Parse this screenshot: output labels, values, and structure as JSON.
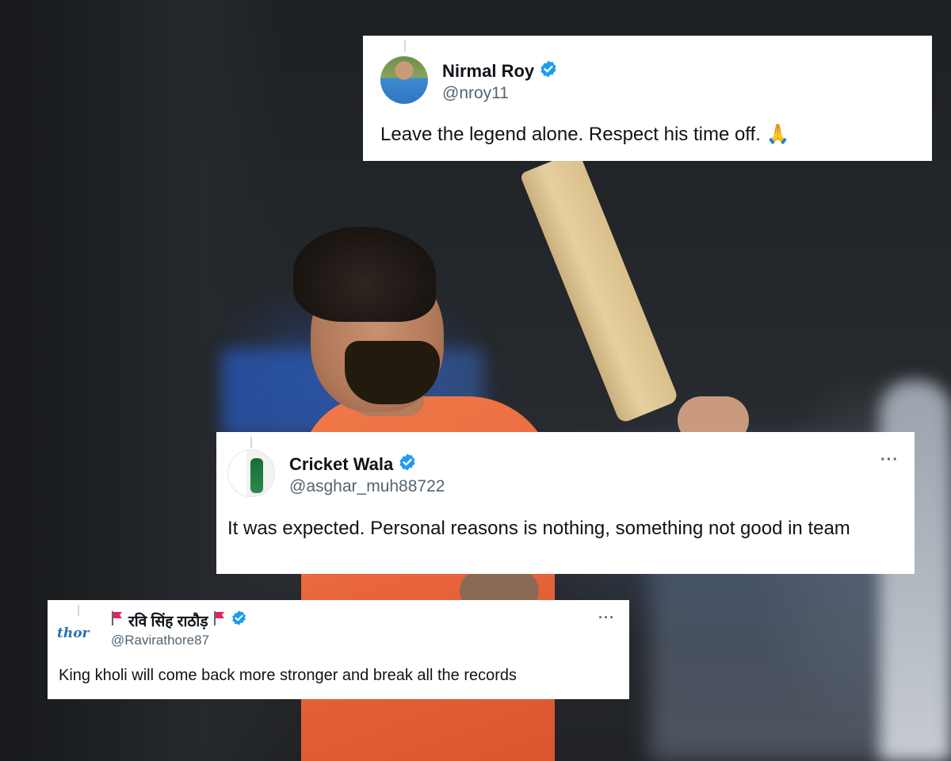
{
  "background": {
    "description_colors": {
      "jersey": "#e8643a",
      "stand": "#1c1e22",
      "board": "#2f6ad0"
    }
  },
  "tweets": [
    {
      "name": "Nirmal Roy",
      "handle": "@nroy11",
      "text": "Leave the legend alone. Respect his time off.",
      "emoji": "🙏",
      "verified": true,
      "avatar_icon": "profile-photo-icon"
    },
    {
      "name": "Cricket Wala",
      "handle": "@asghar_muh88722",
      "text": "It was expected. Personal reasons is nothing, something not good in team",
      "verified": true,
      "more": "···",
      "avatar_icon": "cricketer-photo-icon"
    },
    {
      "name": "रवि सिंह राठौड़",
      "handle": "@Ravirathore87",
      "text": "King kholi will come back more stronger and break all the records",
      "verified": true,
      "more": "···",
      "avatar_logo_text": "thor",
      "avatar_icon": "rathore-logo-icon"
    }
  ],
  "colors": {
    "verified_blue": "#1d9bf0",
    "flag_red": "#e0245e",
    "text_primary": "#0f1419",
    "text_secondary": "#536471"
  }
}
